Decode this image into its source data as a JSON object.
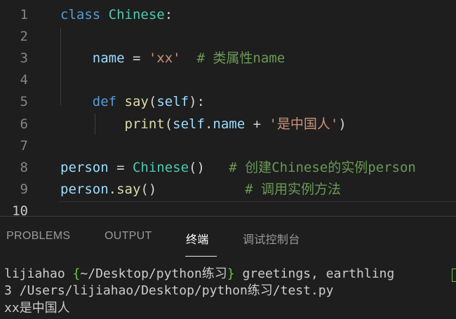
{
  "editor": {
    "lines": [
      {
        "num": "1",
        "code": [
          {
            "t": "class",
            "c": "kw"
          },
          {
            "t": " ",
            "c": "op"
          },
          {
            "t": "Chinese",
            "c": "cls"
          },
          {
            "t": ":",
            "c": "op"
          }
        ]
      },
      {
        "num": "2",
        "code": []
      },
      {
        "num": "3",
        "code": [
          {
            "t": "    name",
            "c": "var"
          },
          {
            "t": " = ",
            "c": "op"
          },
          {
            "t": "'xx'",
            "c": "str"
          },
          {
            "t": "  ",
            "c": "op"
          },
          {
            "t": "# 类属性name",
            "c": "cmt"
          }
        ]
      },
      {
        "num": "4",
        "code": []
      },
      {
        "num": "5",
        "code": [
          {
            "t": "    def",
            "c": "kw"
          },
          {
            "t": " ",
            "c": "op"
          },
          {
            "t": "say",
            "c": "fn"
          },
          {
            "t": "(",
            "c": "op"
          },
          {
            "t": "self",
            "c": "var"
          },
          {
            "t": "):",
            "c": "op"
          }
        ]
      },
      {
        "num": "6",
        "code": [
          {
            "t": "        print",
            "c": "fn"
          },
          {
            "t": "(",
            "c": "op"
          },
          {
            "t": "self",
            "c": "var"
          },
          {
            "t": ".",
            "c": "op"
          },
          {
            "t": "name",
            "c": "var"
          },
          {
            "t": " + ",
            "c": "op"
          },
          {
            "t": "'是中国人'",
            "c": "str"
          },
          {
            "t": ")",
            "c": "op"
          }
        ]
      },
      {
        "num": "7",
        "code": []
      },
      {
        "num": "8",
        "code": [
          {
            "t": "person",
            "c": "var"
          },
          {
            "t": " = ",
            "c": "op"
          },
          {
            "t": "Chinese",
            "c": "cls"
          },
          {
            "t": "()",
            "c": "op"
          },
          {
            "t": "   ",
            "c": "op"
          },
          {
            "t": "# 创建Chinese的实例person",
            "c": "cmt"
          }
        ]
      },
      {
        "num": "9",
        "code": [
          {
            "t": "person",
            "c": "var"
          },
          {
            "t": ".",
            "c": "op"
          },
          {
            "t": "say",
            "c": "fn"
          },
          {
            "t": "()",
            "c": "op"
          },
          {
            "t": "           ",
            "c": "op"
          },
          {
            "t": "# 调用实例方法",
            "c": "cmt"
          }
        ]
      },
      {
        "num": "10",
        "code": []
      }
    ]
  },
  "panel": {
    "tabs": {
      "problems": "PROBLEMS",
      "output": "OUTPUT",
      "terminal": "终端",
      "debug_console": "调试控制台"
    },
    "terminal": {
      "prompt_user": "lijiahao ",
      "prompt_open": "{",
      "prompt_path": "~/Desktop/python练习",
      "prompt_close": "}",
      "prompt_cmd": " greetings, earthling ",
      "line2": "3 /Users/lijiahao/Desktop/python练习/test.py",
      "line3": "xx是中国人"
    }
  },
  "colors": {
    "keyword": "#569cd6",
    "class": "#4ec9b0",
    "variable": "#9cdcfe",
    "function": "#dcdcaa",
    "string": "#ce9178",
    "comment": "#6a9955",
    "prompt_accent": "#6cc644"
  }
}
